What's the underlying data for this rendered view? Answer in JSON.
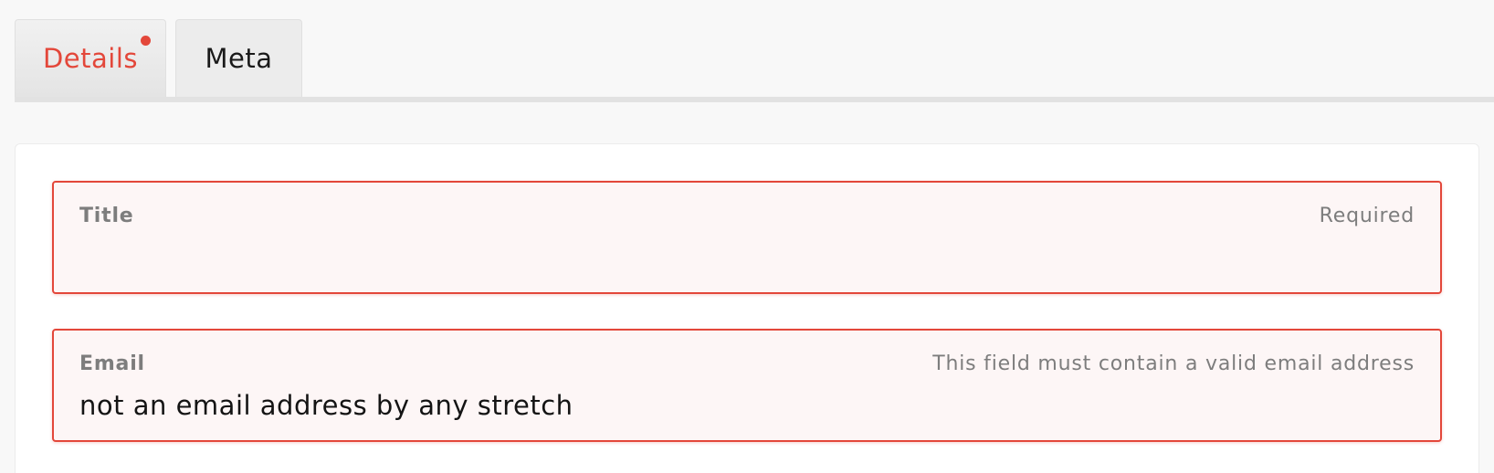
{
  "tabs": [
    {
      "label": "Details",
      "has_error": true
    },
    {
      "label": "Meta",
      "has_error": false
    }
  ],
  "form": {
    "title_field": {
      "label": "Title",
      "message": "Required",
      "value": ""
    },
    "email_field": {
      "label": "Email",
      "message": "This field must contain a valid email address",
      "value": "not an email address by any stretch"
    }
  },
  "colors": {
    "error": "#e3473a",
    "error_bg": "#fdf6f6",
    "label": "#7d7d7d",
    "text": "#141414",
    "page_bg": "#f8f8f8"
  },
  "icons": {
    "error_dot": "error-dot-icon"
  }
}
